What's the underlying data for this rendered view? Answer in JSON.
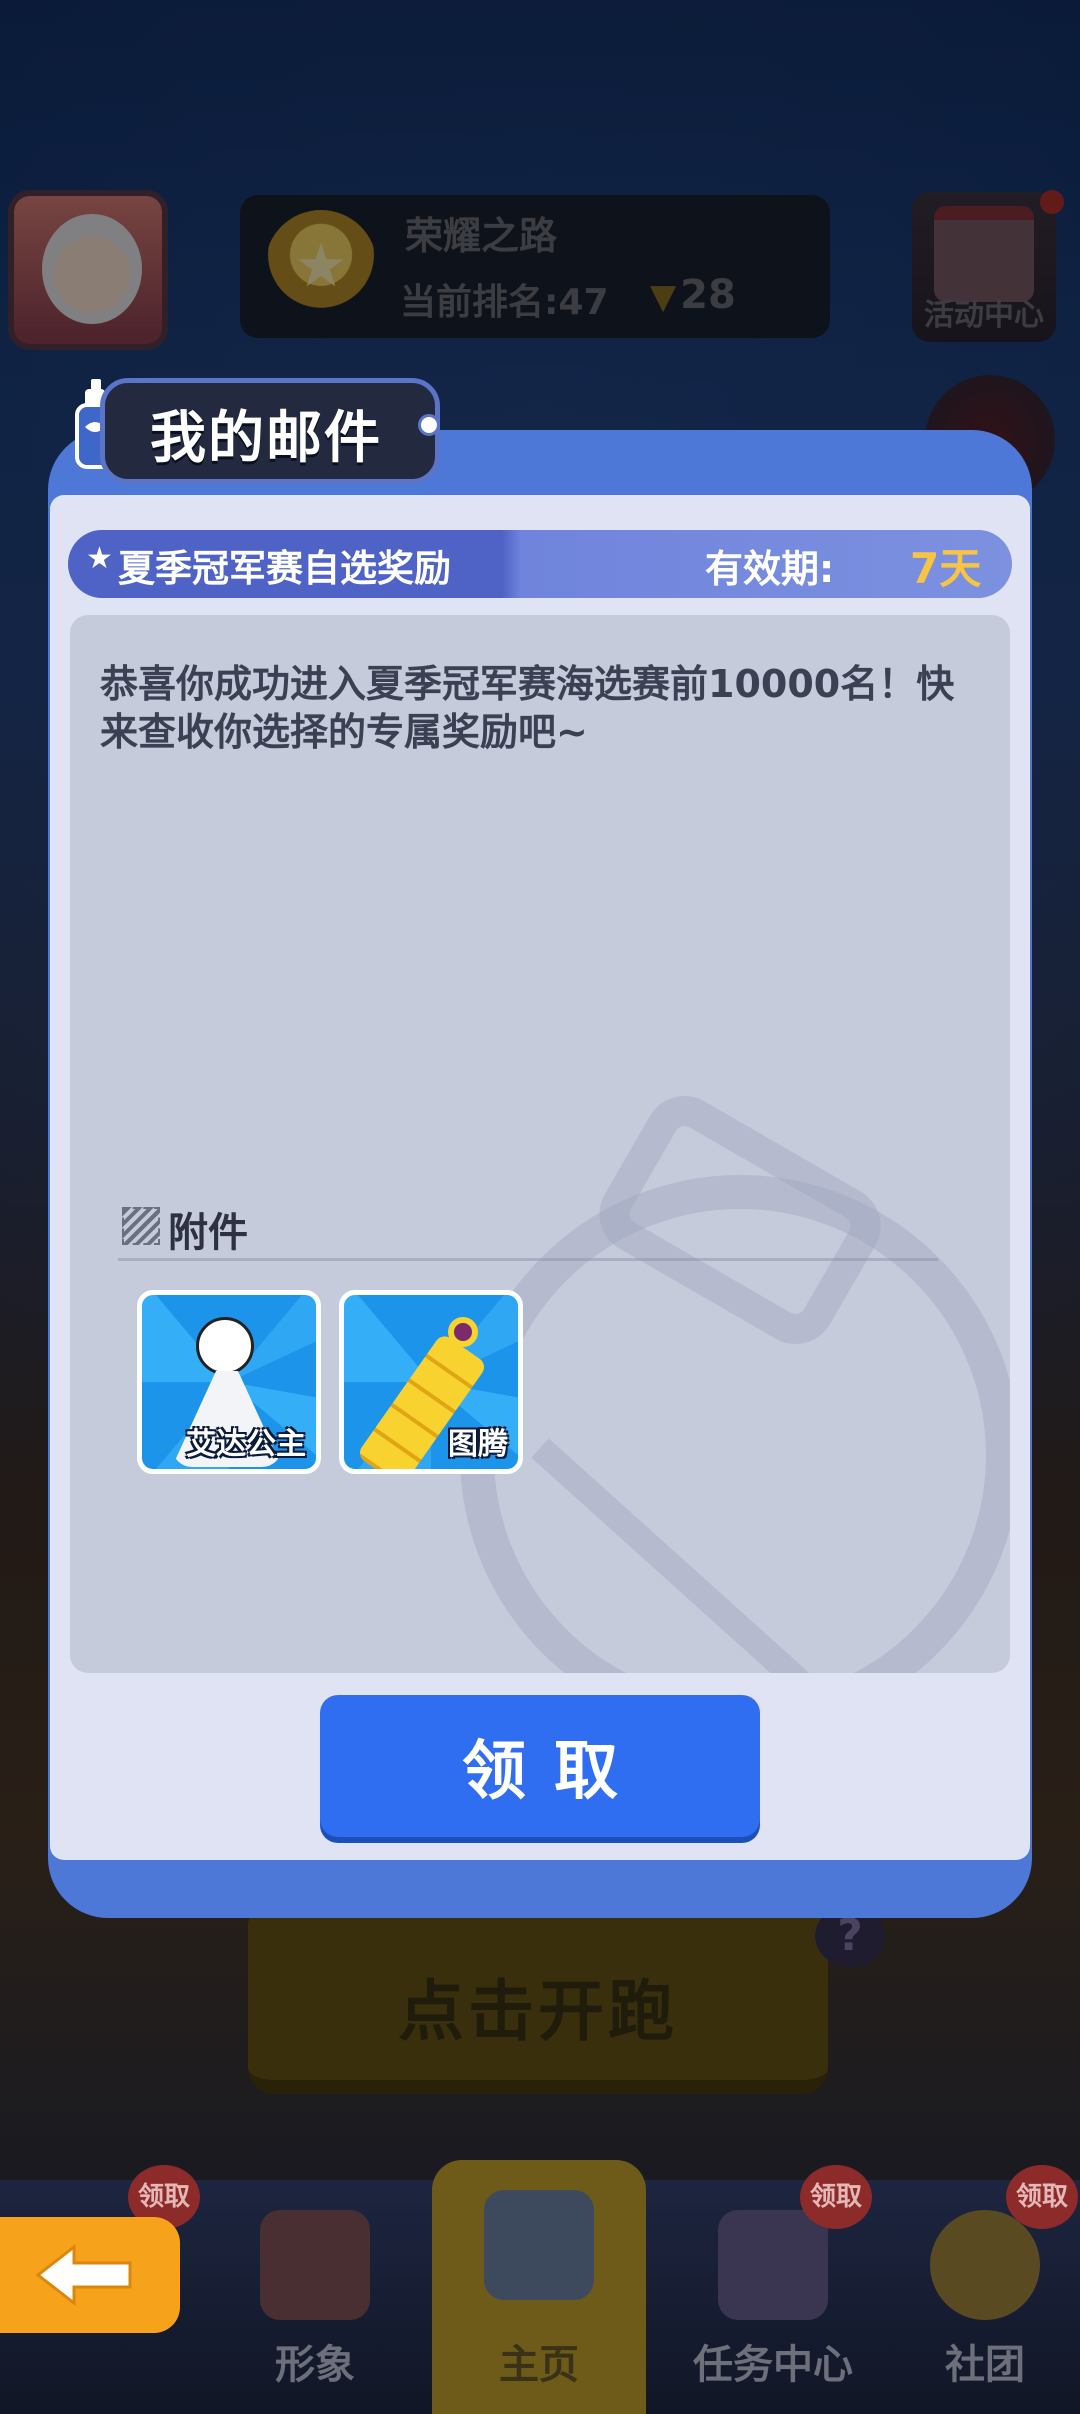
{
  "hud": {
    "rank_title": "荣耀之路",
    "rank_current": "当前排名:47",
    "trophy_count": "28",
    "activity_label": "活动中心"
  },
  "mail": {
    "title": "我的邮件",
    "subject": "夏季冠军赛自选奖励",
    "validity_label": "有效期:",
    "validity_value": "7天",
    "message": "恭喜你成功进入夏季冠军赛海选赛前10000名！快来查收你选择的专属奖励吧~",
    "attachments_label": "附件",
    "attachments": [
      {
        "name": "艾达公主",
        "icon": "ada-princess-icon"
      },
      {
        "name": "图腾",
        "icon": "totem-icon"
      }
    ],
    "claim_label": "领取"
  },
  "background": {
    "start_label": "点击开跑"
  },
  "bottom_nav": {
    "items": [
      {
        "label": "形象"
      },
      {
        "label": "主页"
      },
      {
        "label": "任务中心"
      },
      {
        "label": "社团"
      }
    ],
    "badge_label": "领取"
  },
  "colors": {
    "modal_blue": "#4e78d8",
    "claim_blue": "#2f6ef0",
    "validity_gold": "#f7c443",
    "back_orange": "#f7a21b"
  }
}
